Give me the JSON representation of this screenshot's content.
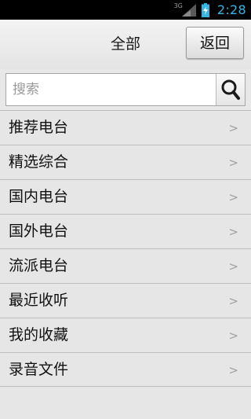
{
  "status_bar": {
    "network_type": "3G",
    "time": "2:28"
  },
  "header": {
    "title": "全部",
    "back_label": "返回"
  },
  "search": {
    "placeholder": "搜索",
    "value": ""
  },
  "menu": {
    "chevron": ">",
    "items": [
      {
        "label": "推荐电台"
      },
      {
        "label": "精选综合"
      },
      {
        "label": "国内电台"
      },
      {
        "label": "国外电台"
      },
      {
        "label": "流派电台"
      },
      {
        "label": "最近收听"
      },
      {
        "label": "我的收藏"
      },
      {
        "label": "录音文件"
      }
    ]
  },
  "colors": {
    "clock": "#33b5e5",
    "background": "#e6e6e6",
    "divider": "#bdbdbd"
  }
}
